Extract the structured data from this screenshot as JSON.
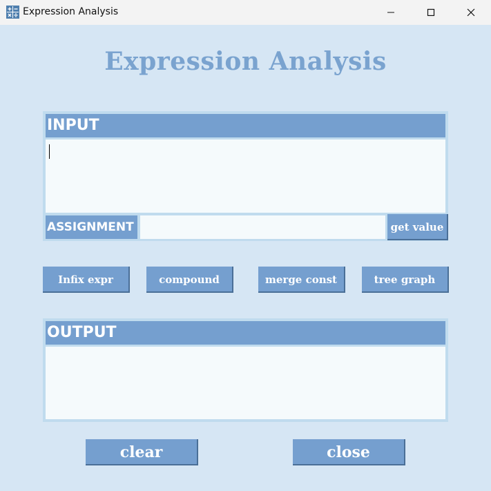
{
  "window": {
    "title": "Expression Analysis",
    "app_icon": "calculator-icon"
  },
  "controls": {
    "minimize_icon": "minimize-icon",
    "maximize_icon": "maximize-icon",
    "close_icon": "close-icon"
  },
  "heading": "Expression Analysis",
  "input": {
    "header": "INPUT",
    "value": "",
    "assignment_label": "ASSIGNMENT",
    "assignment_value": "",
    "get_value_label": "get value"
  },
  "operations": [
    {
      "label": "Infix expr"
    },
    {
      "label": "compound"
    },
    {
      "label": "merge const"
    },
    {
      "label": "tree graph"
    }
  ],
  "output": {
    "header": "OUTPUT",
    "value": ""
  },
  "footer": {
    "clear_label": "clear",
    "close_label": "close"
  },
  "colors": {
    "background": "#d6e6f4",
    "accent": "#759fcf",
    "heading": "#7aa3cf",
    "field": "#f5fafc"
  }
}
